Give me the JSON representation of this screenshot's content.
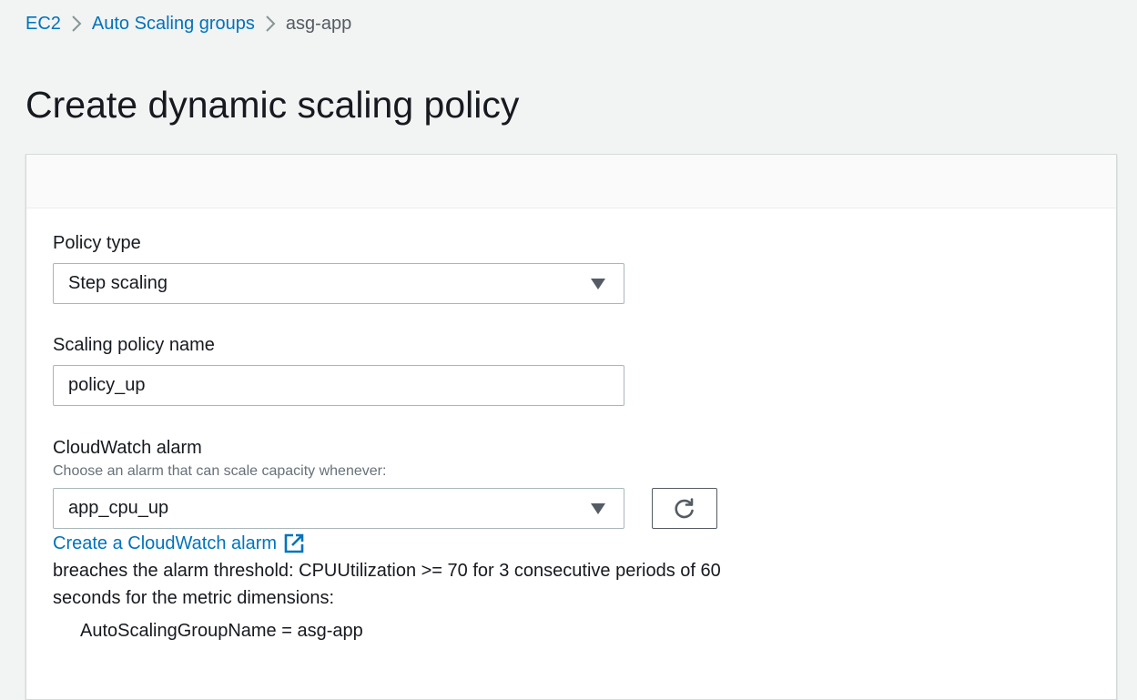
{
  "breadcrumb": {
    "items": [
      {
        "label": "EC2"
      },
      {
        "label": "Auto Scaling groups"
      },
      {
        "label": "asg-app"
      }
    ],
    "separator_icon": "chevron-right-icon"
  },
  "page": {
    "title": "Create dynamic scaling policy"
  },
  "form": {
    "policy_type": {
      "label": "Policy type",
      "value": "Step scaling",
      "icon": "caret-down-icon"
    },
    "policy_name": {
      "label": "Scaling policy name",
      "value": "policy_up"
    },
    "alarm": {
      "label": "CloudWatch alarm",
      "description": "Choose an alarm that can scale capacity whenever:",
      "value": "app_cpu_up",
      "refresh_icon": "refresh-icon",
      "create_link": "Create a CloudWatch alarm",
      "external_icon": "external-link-icon",
      "condition_text": "breaches the alarm threshold: CPUUtilization >= 70 for 3 consecutive periods of 60 seconds for the metric dimensions:",
      "dimension_text": "AutoScalingGroupName = asg-app"
    }
  },
  "colors": {
    "link": "#0073bb",
    "text": "#16191f",
    "secondary_text": "#687078",
    "background": "#f2f3f3",
    "border": "#aab7b8"
  }
}
